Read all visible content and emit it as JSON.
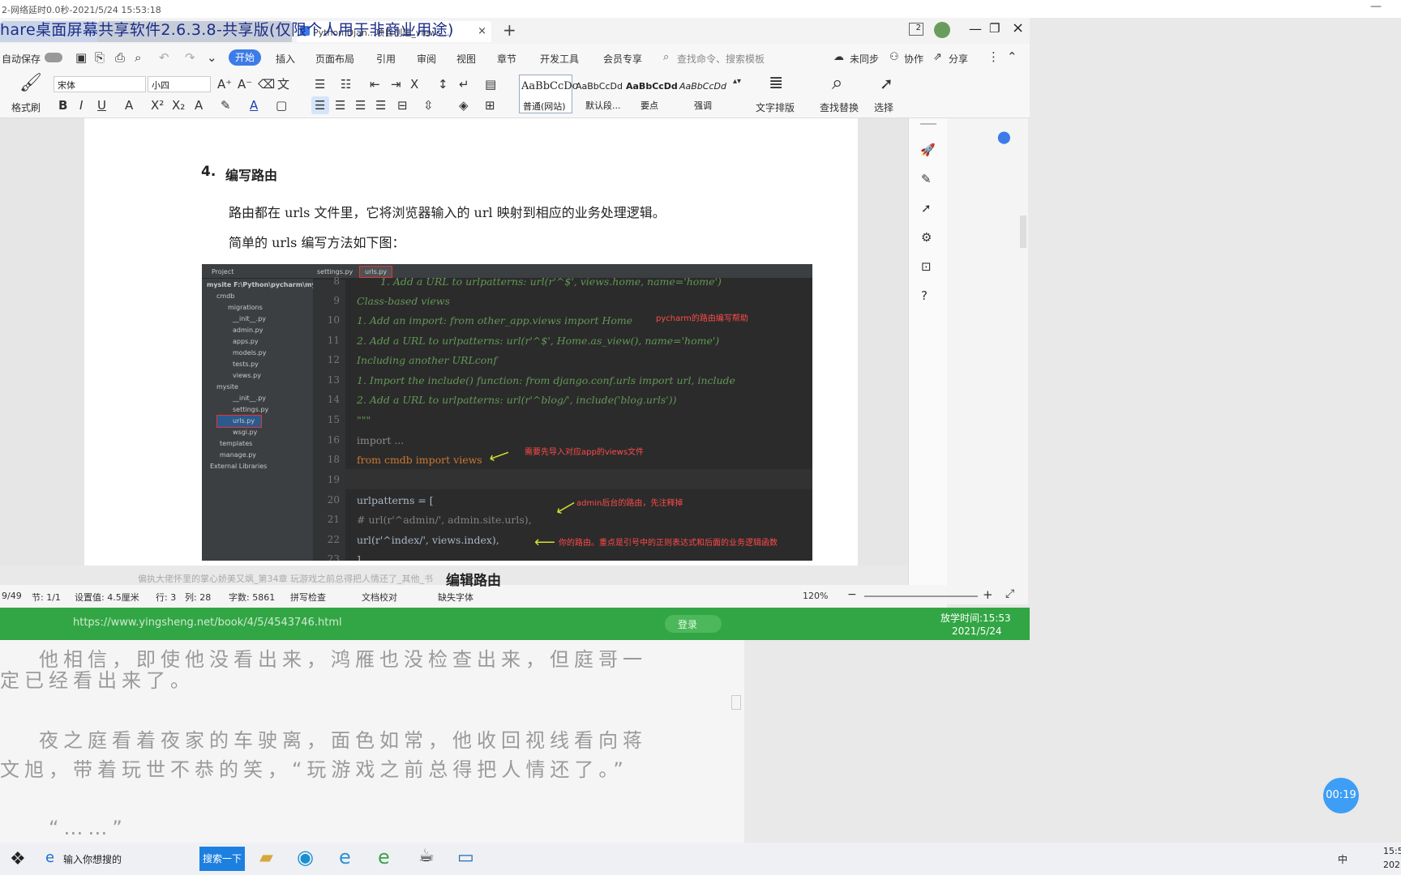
{
  "status_top": "2-网络延时0.0秒-2021/5/24 15:53:18",
  "overlay_title": "hare桌面屏幕共享软件2.6.3.8-共享版(仅限个人用于非商业用途)",
  "tabs": [
    {
      "label": "Python Djan...项目创建_views..."
    }
  ],
  "titlebar_badge": "2",
  "menubar": {
    "autosave": "自动保存",
    "items": [
      "开始",
      "插入",
      "页面布局",
      "引用",
      "审阅",
      "视图",
      "章节",
      "开发工具",
      "会员专享"
    ],
    "search_placeholder": "查找命令、搜索模板",
    "sync": "未同步",
    "collab": "协作",
    "share": "分享"
  },
  "ribbon": {
    "format_painter": "格式刷",
    "font": "宋体",
    "size": "小四",
    "styles": [
      {
        "preview": "AaBbCcDc",
        "name": "普通(网站)"
      },
      {
        "preview": "AaBbCcDd",
        "name": "默认段..."
      },
      {
        "preview": "AaBbCcDd",
        "name": "要点"
      },
      {
        "preview": "AaBbCcDd",
        "name": "强调"
      }
    ],
    "text_layout": "文字排版",
    "find_replace": "查找替换",
    "select": "选择"
  },
  "doc": {
    "heading_num": "4.",
    "heading": "编写路由",
    "para1": "路由都在 urls 文件里，它将浏览器输入的 url 映射到相应的业务处理逻辑。",
    "para2": "简单的 urls 编写方法如下图："
  },
  "code": {
    "tabs": [
      "Project",
      "settings.py",
      "urls.py"
    ],
    "tree": [
      "mysite  F:\\Python\\pycharm\\mysit",
      "cmdb",
      "migrations",
      "__init__.py",
      "admin.py",
      "apps.py",
      "models.py",
      "tests.py",
      "views.py",
      "mysite",
      "__init__.py",
      "settings.py",
      "urls.py",
      "wsgi.py",
      "templates",
      "manage.py",
      "External Libraries"
    ],
    "lines": [
      {
        "no": "8",
        "text": "1. Add a URL to urlpatterns:  url(r'^$', views.home, name='home')"
      },
      {
        "no": "9",
        "text": "Class-based views"
      },
      {
        "no": "10",
        "text": "    1. Add an import:  from other_app.views import Home"
      },
      {
        "no": "11",
        "text": "    2. Add a URL to urlpatterns:  url(r'^$', Home.as_view(), name='home')"
      },
      {
        "no": "12",
        "text": "Including another URLconf"
      },
      {
        "no": "13",
        "text": "    1. Import the include() function: from django.conf.urls import url, include"
      },
      {
        "no": "14",
        "text": "    2. Add a URL to urlpatterns:  url(r'^blog/', include('blog.urls'))"
      },
      {
        "no": "15",
        "text": "\"\"\""
      },
      {
        "no": "16",
        "text": "import ..."
      },
      {
        "no": "18",
        "text": "from cmdb import views"
      },
      {
        "no": "19",
        "text": ""
      },
      {
        "no": "20",
        "text": "urlpatterns = ["
      },
      {
        "no": "21",
        "text": "    # url(r'^admin/', admin.site.urls),"
      },
      {
        "no": "22",
        "text": "    url(r'^index/', views.index),"
      },
      {
        "no": "23",
        "text": "]"
      }
    ],
    "annotations": [
      "pycharm的路由编写帮助",
      "需要先导入对应app的views文件",
      "admin后台的路由，先注释掉",
      "你的路由。重点是引号中的正则表达式和后面的业务逻辑函数"
    ]
  },
  "statusbar": {
    "page": "9/49",
    "section": "节: 1/1",
    "setting": "设置值: 4.5厘米",
    "row": "行: 3",
    "col": "列: 28",
    "words": "字数: 5861",
    "spell": "拼写检查",
    "proof": "文档校对",
    "missing_font": "缺失字体",
    "zoom": "120%"
  },
  "reader_bar": {
    "text": "偏执大佬怀里的掌心娇美又飒_第34章 玩游戏之前总得把人情还了_其他_书",
    "overlay": "编辑路由"
  },
  "green": {
    "url": "https://www.yingsheng.net/book/4/5/4543746.html",
    "login": "登录",
    "clock": "放学时间:15:53",
    "date": "2021/5/24"
  },
  "reader_text": [
    "他相信，即使他没看出来，鸿雁也没检查出来，但庭哥一",
    "定已经看出来了。",
    "夜之庭看着夜家的车驶离，面色如常，他收回视线看向蒋",
    "文旭，带着玩世不恭的笑，“玩游戏之前总得把人情还了。”",
    "“……”"
  ],
  "timer": "00:19",
  "taskbar": {
    "search": "输入你想搜的",
    "search_btn": "搜索一下",
    "tray": "中",
    "time": "15:5",
    "date": "202"
  },
  "colors": {
    "accent": "#3c7be8",
    "green": "#32a644",
    "code_bg": "#2b2b2b",
    "annotation": "#ff4a4a"
  }
}
